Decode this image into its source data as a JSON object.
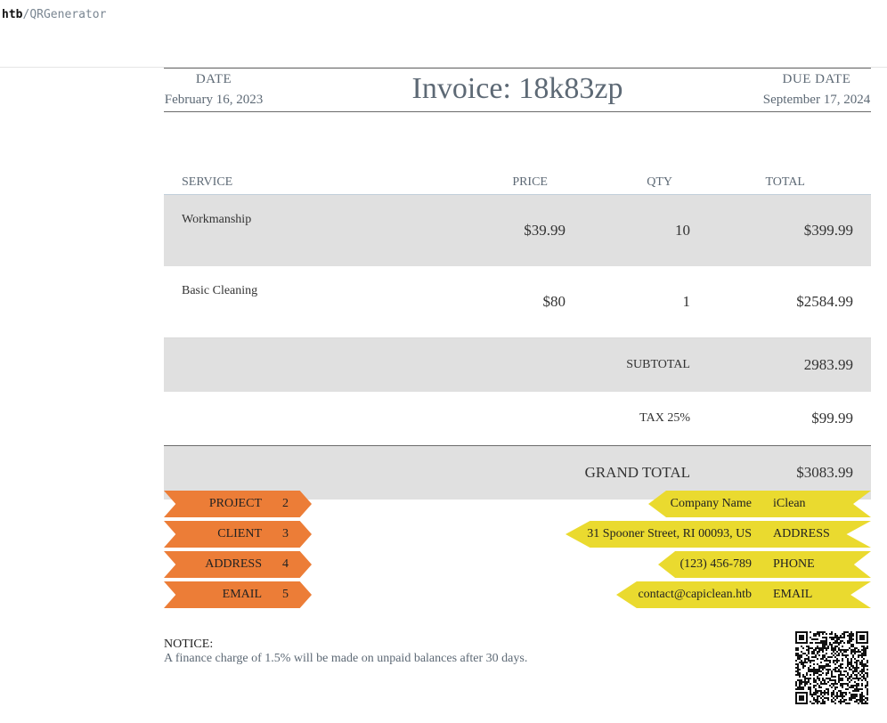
{
  "breadcrumb": {
    "root": "htb",
    "separator": "/",
    "page": "QRGenerator"
  },
  "invoice": {
    "title": "Invoice: 18k83zp",
    "date_label": "DATE",
    "date_value": "February 16, 2023",
    "due_label": "DUE DATE",
    "due_value": "September 17, 2024"
  },
  "table": {
    "headers": {
      "service": "SERVICE",
      "price": "PRICE",
      "qty": "QTY",
      "total": "TOTAL"
    },
    "rows": [
      {
        "service": "Workmanship",
        "price": "$39.99",
        "qty": "10",
        "total": "$399.99"
      },
      {
        "service": "Basic Cleaning",
        "price": "$80",
        "qty": "1",
        "total": "$2584.99"
      }
    ],
    "subtotal_label": "SUBTOTAL",
    "subtotal_value": "2983.99",
    "tax_label": "TAX 25%",
    "tax_value": "$99.99",
    "grand_label": "GRAND TOTAL",
    "grand_value": "$3083.99"
  },
  "left_ribbons": [
    {
      "label": "PROJECT",
      "value": "2"
    },
    {
      "label": "CLIENT",
      "value": "3"
    },
    {
      "label": "ADDRESS",
      "value": "4"
    },
    {
      "label": "EMAIL",
      "value": "5"
    }
  ],
  "right_ribbons": [
    {
      "value": "Company Name",
      "label": "iClean"
    },
    {
      "value": "31 Spooner Street, RI 00093, US",
      "label": "ADDRESS"
    },
    {
      "value": "(123) 456-789",
      "label": "PHONE"
    },
    {
      "value": "contact@capiclean.htb",
      "label": "EMAIL"
    }
  ],
  "notice": {
    "title": "NOTICE:",
    "text": "A finance charge of 1.5% will be made on unpaid balances after 30 days."
  },
  "colors": {
    "orange": "#ec7d37",
    "yellow": "#eada2f",
    "shade": "#e0e0e0",
    "text": "#5d6975"
  },
  "qr_icon": "qr-code-icon"
}
